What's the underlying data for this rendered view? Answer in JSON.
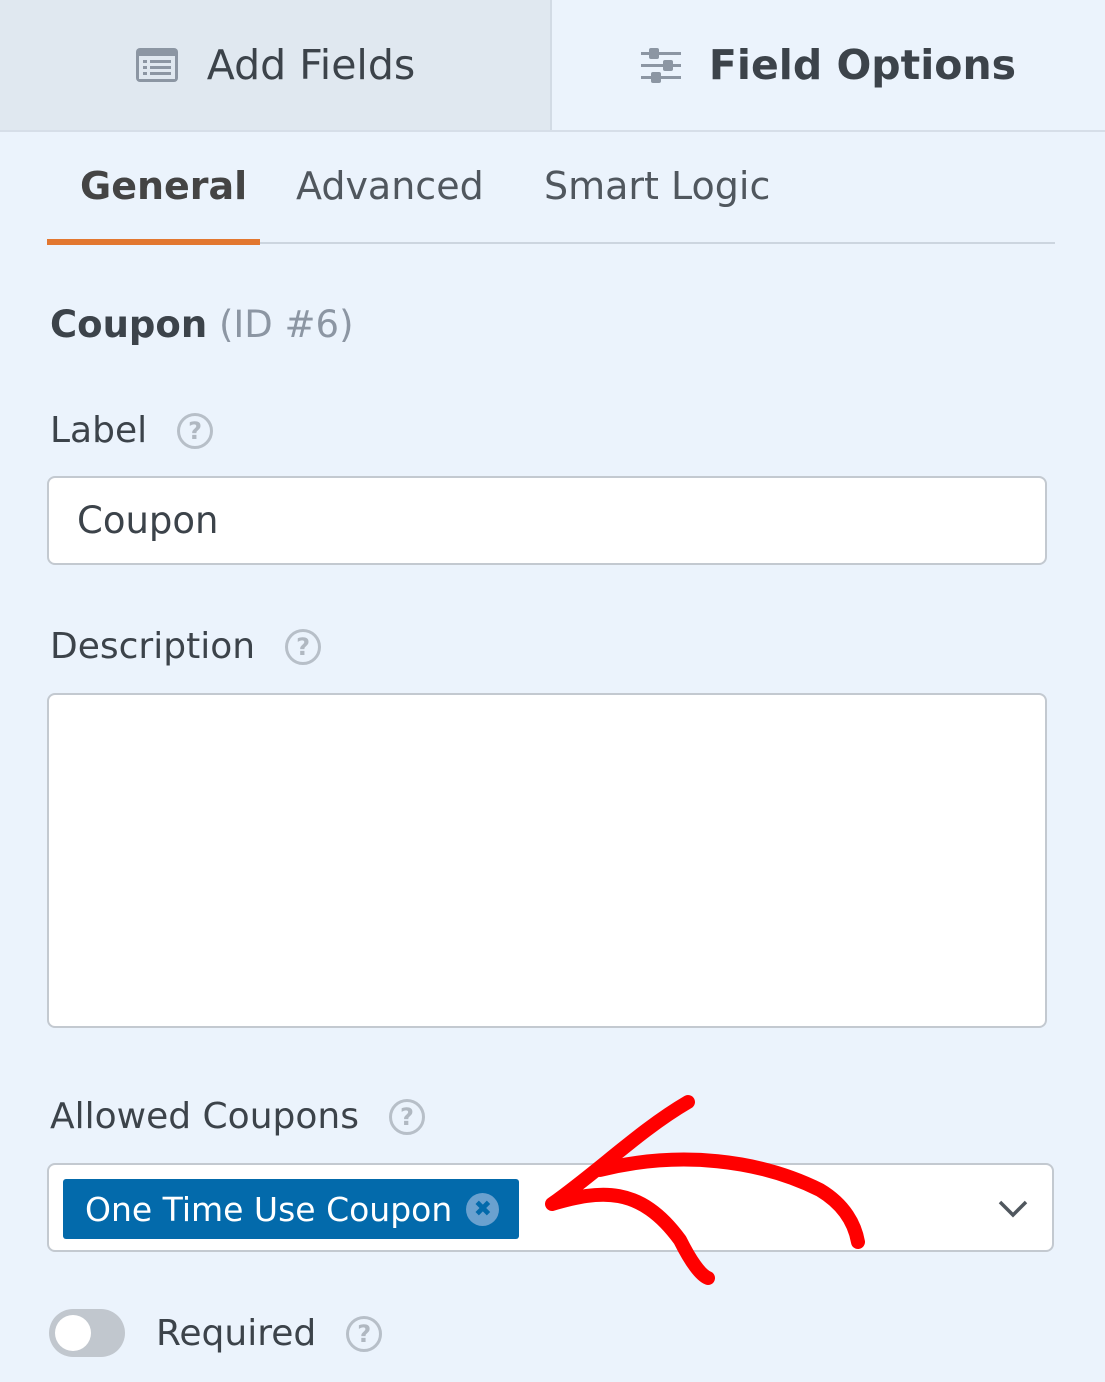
{
  "top_tabs": {
    "add_fields": {
      "label": "Add Fields",
      "icon": "list-icon"
    },
    "field_options": {
      "label": "Field Options",
      "icon": "sliders-icon",
      "active": true
    }
  },
  "sub_tabs": [
    {
      "label": "General",
      "active": true
    },
    {
      "label": "Advanced",
      "active": false
    },
    {
      "label": "Smart Logic",
      "active": false
    }
  ],
  "field": {
    "name": "Coupon",
    "id_text": "(ID #6)"
  },
  "label_field": {
    "label": "Label",
    "value": "Coupon",
    "help": "?"
  },
  "description_field": {
    "label": "Description",
    "value": "",
    "help": "?"
  },
  "allowed_coupons": {
    "label": "Allowed Coupons",
    "help": "?",
    "selected": [
      "One Time Use Coupon"
    ],
    "remove_glyph": "✖"
  },
  "required": {
    "label": "Required",
    "enabled": false,
    "help": "?"
  },
  "colors": {
    "accent": "#e27730",
    "chip": "#036aab",
    "annotation": "#ff0000"
  }
}
